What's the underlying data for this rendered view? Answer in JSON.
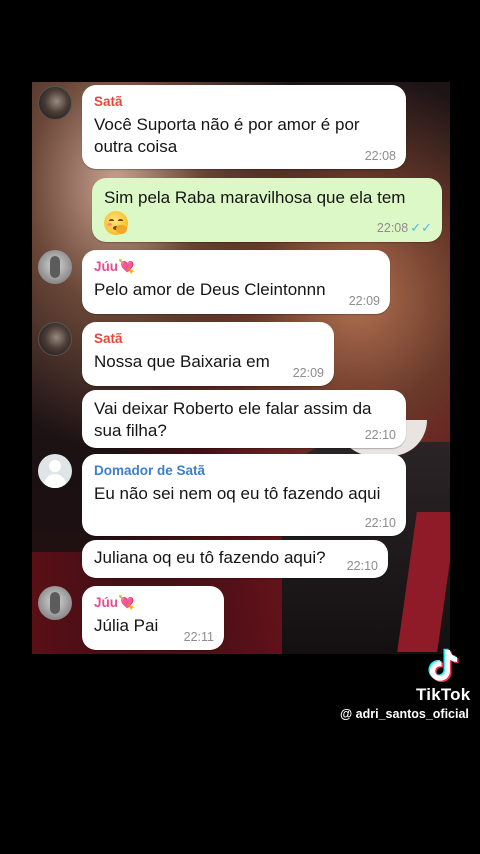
{
  "app": {
    "brand": "TikTok",
    "username": "@ adri_santos_oficial"
  },
  "colors": {
    "sender_sata": "#e8463d",
    "sender_juu": "#e84d8a",
    "sender_domador": "#3b7fd0",
    "outgoing_bubble": "#dcf8c6",
    "read_ticks": "#4fb6ec"
  },
  "messages": [
    {
      "sender": "Satã",
      "text": "Você Suporta não é por amor é por outra coisa",
      "time": "22:08"
    },
    {
      "sender": "",
      "text": "Sim pela Raba maravilhosa que ela tem",
      "emoji": "face-with-hand-over-mouth",
      "time": "22:08",
      "status": "✓✓"
    },
    {
      "sender": "Júu💘",
      "text": "Pelo amor de Deus Cleintonnn",
      "time": "22:09"
    },
    {
      "sender": "Satã",
      "text": "Nossa que Baixaria em",
      "time": "22:09"
    },
    {
      "sender": "",
      "text": "Vai deixar Roberto ele falar assim da sua filha?",
      "time": "22:10"
    },
    {
      "sender": "Domador de Satã",
      "text": "Eu não sei nem oq eu tô fazendo aqui",
      "time": "22:10"
    },
    {
      "sender": "",
      "text": "Juliana oq eu tô fazendo aqui?",
      "time": "22:10"
    },
    {
      "sender": "Júu💘",
      "text": "Júlia Pai",
      "time": "22:11"
    }
  ]
}
